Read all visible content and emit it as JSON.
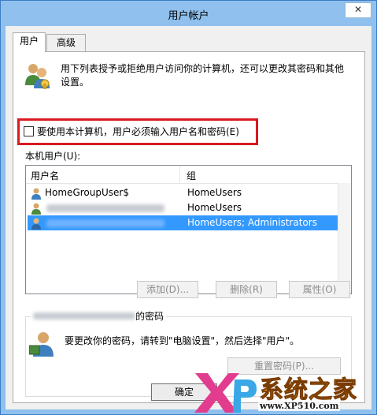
{
  "window": {
    "title": "用户帐户",
    "close_label": "✕"
  },
  "tabs": [
    {
      "label": "用户",
      "active": true
    },
    {
      "label": "高级",
      "active": false
    }
  ],
  "description": "用下列表授予或拒绝用户访问你的计算机，还可以更改其密码和其他设置。",
  "require_login_checkbox": {
    "label": "要使用本计算机，用户必须输入用户名和密码(E)",
    "checked": false
  },
  "local_users_label": "本机用户(U):",
  "user_list": {
    "columns": [
      "用户名",
      "组"
    ],
    "rows": [
      {
        "name": "HomeGroupUser$",
        "group": "HomeUsers",
        "selected": false
      },
      {
        "name": "",
        "group": "HomeUsers",
        "selected": false
      },
      {
        "name": "",
        "group": "HomeUsers; Administrators",
        "selected": true
      }
    ]
  },
  "buttons": {
    "add": "添加(D)...",
    "remove": "删除(R)",
    "properties": "属性(O)"
  },
  "password_group": {
    "title_suffix": "的密码",
    "text": "要更改你的密码，请转到\"电脑设置\"，然后选择\"用户\"。",
    "reset_button": "重置密码(P)..."
  },
  "footer": {
    "ok": "确定"
  },
  "watermark": {
    "logo": "XP",
    "brand": "系统之家",
    "url": "www.XP510.com"
  },
  "colors": {
    "selection": "#3399ff",
    "highlight_border": "#d91a21",
    "title_bar": "#8fc0ee"
  }
}
